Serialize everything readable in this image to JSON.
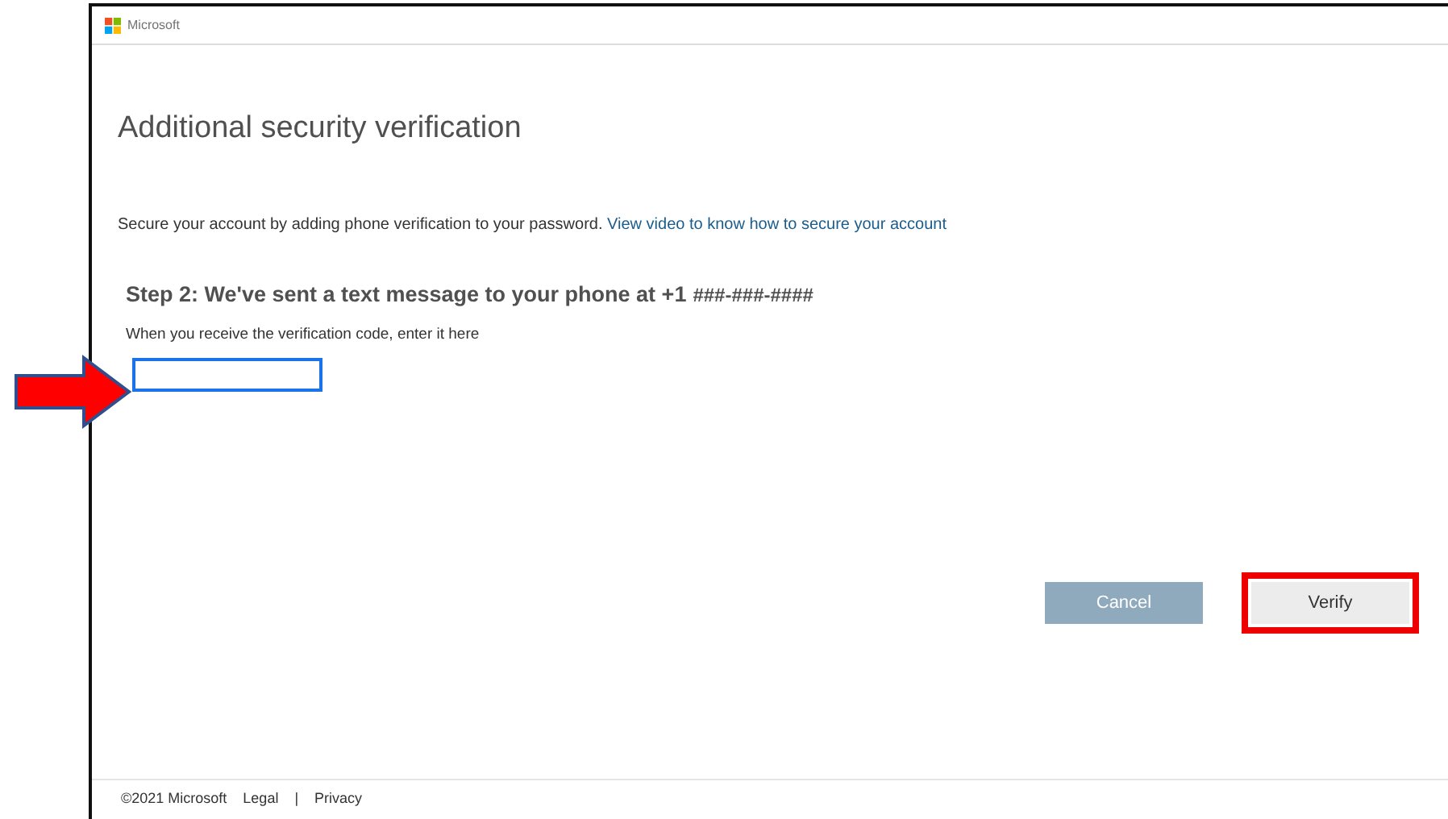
{
  "header": {
    "logo_text": "Microsoft"
  },
  "title": "Additional security verification",
  "intro": {
    "text": "Secure your account by adding phone verification to your password.",
    "link": "View video to know how to secure your account"
  },
  "step": {
    "heading": "Step 2: We've sent a text message to your phone at +1",
    "number": "###-###-####"
  },
  "code_field": {
    "label": "When you receive the verification code, enter it here",
    "focused": true
  },
  "buttons": [
    {
      "label": "Cancel",
      "kind": "secondary",
      "highlighted": false
    },
    {
      "label": "Verify",
      "kind": "primary",
      "highlighted": true
    }
  ],
  "footer": {
    "copyright": "©2021 Microsoft",
    "links": [
      "Legal",
      "Privacy"
    ],
    "separator": "|"
  }
}
